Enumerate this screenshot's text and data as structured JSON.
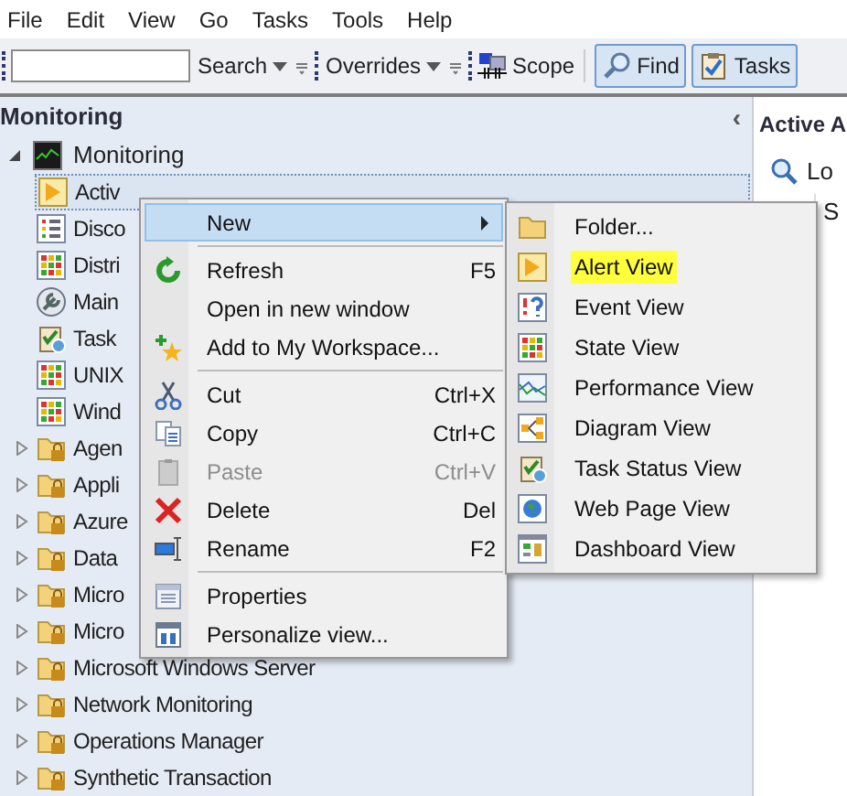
{
  "menu_bar": [
    "File",
    "Edit",
    "View",
    "Go",
    "Tasks",
    "Tools",
    "Help"
  ],
  "toolbar": {
    "search_button": "Search",
    "overrides_button": "Overrides",
    "scope_button": "Scope",
    "find_button": {
      "label": "Find",
      "selected": true
    },
    "tasks_button": {
      "label": "Tasks",
      "selected": true
    }
  },
  "navigation": {
    "title": "Monitoring",
    "collapse_glyph": "‹",
    "tree": [
      {
        "label": "Monitoring",
        "expanded": true,
        "children": [
          {
            "label": "Activ",
            "kind": "alert",
            "selected": true
          },
          {
            "label": "Disco",
            "kind": "list",
            "selected": false
          },
          {
            "label": "Distri",
            "kind": "state",
            "selected": false
          },
          {
            "label": "Main",
            "kind": "maintenance",
            "selected": false
          },
          {
            "label": "Task",
            "kind": "task",
            "selected": false
          },
          {
            "label": "UNIX",
            "kind": "state",
            "selected": false
          },
          {
            "label": "Wind",
            "kind": "state",
            "selected": false
          },
          {
            "label": "Agen",
            "kind": "folder",
            "selected": false
          },
          {
            "label": "Appli",
            "kind": "folder",
            "selected": false
          },
          {
            "label": "Azure",
            "kind": "folder",
            "selected": false
          },
          {
            "label": "Data",
            "kind": "folder",
            "selected": false
          },
          {
            "label": "Micro",
            "kind": "folder",
            "selected": false
          },
          {
            "label": "Micro",
            "kind": "folder",
            "selected": false
          },
          {
            "label": "Microsoft Windows Server",
            "kind": "folder",
            "selected": false
          },
          {
            "label": "Network Monitoring",
            "kind": "folder",
            "selected": false
          },
          {
            "label": "Operations Manager",
            "kind": "folder",
            "selected": false
          },
          {
            "label": "Synthetic Transaction",
            "kind": "folder",
            "selected": false
          }
        ]
      }
    ]
  },
  "context_menu": [
    {
      "kind": "submenu",
      "label": "New",
      "selected": true
    },
    {
      "kind": "separator"
    },
    {
      "kind": "item",
      "label": "Refresh",
      "shortcut": "F5",
      "disabled": false
    },
    {
      "kind": "item",
      "label": "Open in new window",
      "disabled": false
    },
    {
      "kind": "item",
      "label": "Add to My Workspace...",
      "disabled": false
    },
    {
      "kind": "separator"
    },
    {
      "kind": "item",
      "label": "Cut",
      "shortcut": "Ctrl+X",
      "disabled": false
    },
    {
      "kind": "item",
      "label": "Copy",
      "shortcut": "Ctrl+C",
      "disabled": false
    },
    {
      "kind": "item",
      "label": "Paste",
      "shortcut": "Ctrl+V",
      "disabled": true
    },
    {
      "kind": "item",
      "label": "Delete",
      "shortcut": "Del",
      "disabled": false
    },
    {
      "kind": "item",
      "label": "Rename",
      "shortcut": "F2",
      "disabled": false
    },
    {
      "kind": "separator"
    },
    {
      "kind": "item",
      "label": "Properties",
      "disabled": false
    },
    {
      "kind": "item",
      "label": "Personalize view...",
      "disabled": false
    }
  ],
  "submenu": [
    {
      "label": "Folder...",
      "kind": "folder",
      "highlighted": false
    },
    {
      "label": "Alert View",
      "kind": "alert",
      "highlighted": true
    },
    {
      "label": "Event View",
      "kind": "event",
      "highlighted": false
    },
    {
      "label": "State View",
      "kind": "state",
      "highlighted": false
    },
    {
      "label": "Performance View",
      "kind": "performance",
      "highlighted": false
    },
    {
      "label": "Diagram View",
      "kind": "diagram",
      "highlighted": false
    },
    {
      "label": "Task Status View",
      "kind": "task",
      "highlighted": false
    },
    {
      "label": "Web Page View",
      "kind": "web",
      "highlighted": false
    },
    {
      "label": "Dashboard View",
      "kind": "dashboard",
      "highlighted": false
    }
  ],
  "details_pane": {
    "title": "Active A",
    "search_label": "Lo",
    "column_1": "S"
  }
}
